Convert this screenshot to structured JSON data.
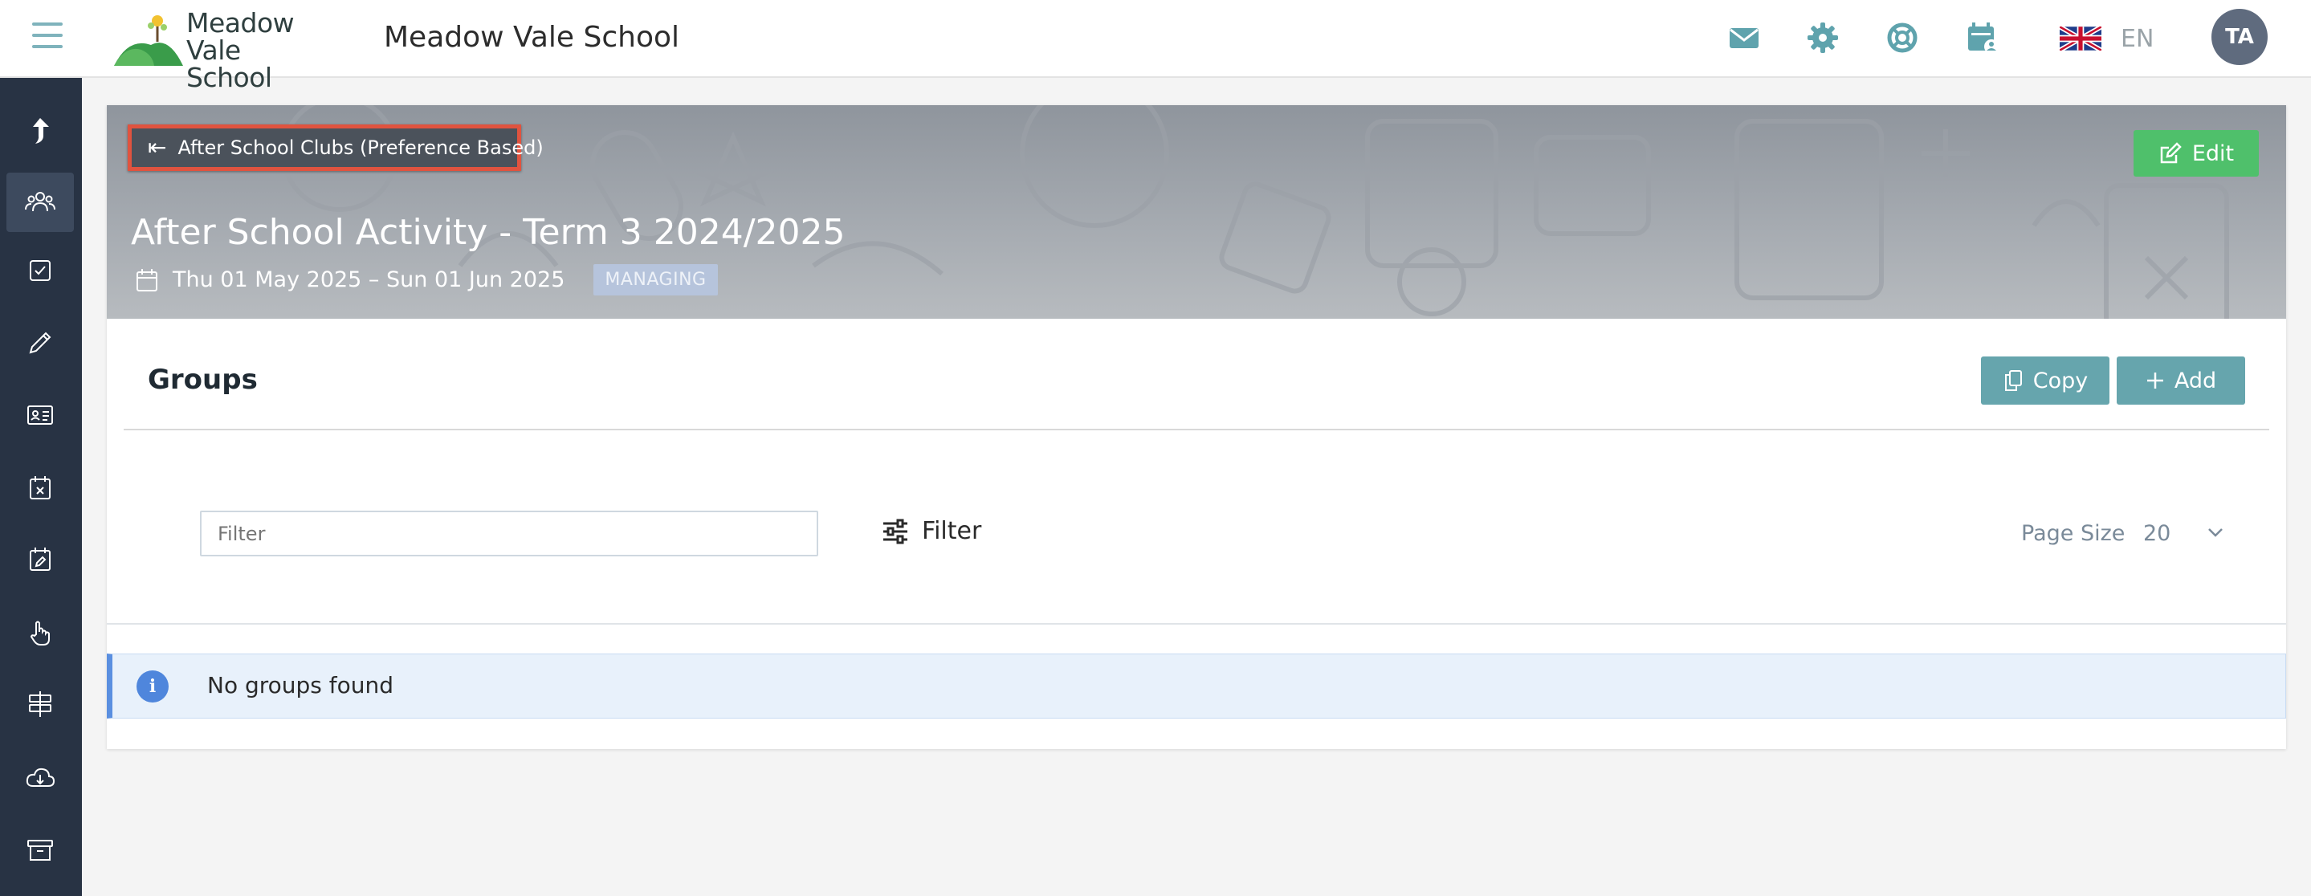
{
  "header": {
    "logo_line1": "Meadow",
    "logo_line2": "Vale School",
    "school_name": "Meadow Vale School",
    "language": "EN",
    "avatar_initials": "TA",
    "accent_color": "#5fa3ad"
  },
  "sidebar": {
    "items": [
      {
        "icon": "share-arrow-icon"
      },
      {
        "icon": "users-icon",
        "active": true
      },
      {
        "icon": "checkbox-icon"
      },
      {
        "icon": "pencil-icon"
      },
      {
        "icon": "id-card-icon"
      },
      {
        "icon": "calendar-x-icon"
      },
      {
        "icon": "calendar-edit-icon"
      },
      {
        "icon": "hand-pointer-icon"
      },
      {
        "icon": "signpost-icon"
      },
      {
        "icon": "cloud-download-icon"
      },
      {
        "icon": "archive-icon"
      }
    ]
  },
  "banner": {
    "back_label": "After School Clubs (Preference Based)",
    "edit_label": "Edit",
    "title": "After School Activity - Term 3 2024/2025",
    "date_range": "Thu 01 May 2025 – Sun 01 Jun 2025",
    "badge": "MANAGING"
  },
  "groups": {
    "heading": "Groups",
    "copy_label": "Copy",
    "add_label": "Add",
    "filter_placeholder": "Filter",
    "filter_button": "Filter",
    "page_size_label": "Page Size",
    "page_size_value": "20",
    "empty_message": "No groups found"
  }
}
